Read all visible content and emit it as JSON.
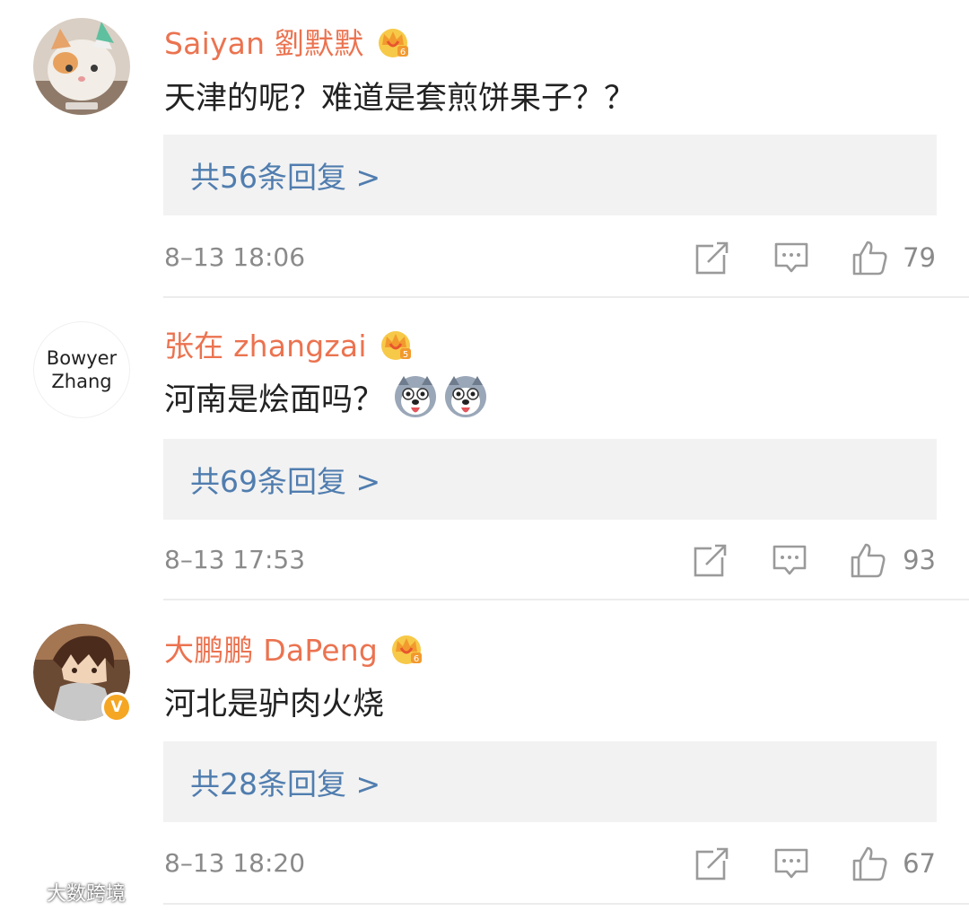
{
  "comments": [
    {
      "username": "Saiyan 劉默默",
      "level_badge": "6",
      "text": "天津的呢？难道是套煎饼果子？？",
      "replies": "共56条回复 >",
      "time": "8–13 18:06",
      "likes": "79",
      "avatar": "cat-photo"
    },
    {
      "username": "张在 zhangzai",
      "level_badge": "5",
      "text": "河南是烩面吗？",
      "replies": "共69条回复 >",
      "time": "8–13 17:53",
      "likes": "93",
      "avatar_text_line1": "Bowyer",
      "avatar_text_line2": "Zhang",
      "emojis": [
        "husky-emoji",
        "husky-emoji"
      ]
    },
    {
      "username": "大鹏鹏 DaPeng",
      "level_badge": "6",
      "text": "河北是驴肉火烧",
      "replies": "共28条回复 >",
      "time": "8–13 18:20",
      "likes": "67",
      "avatar": "anime-boy",
      "verified_badge": "V"
    }
  ],
  "watermark": "大数跨境",
  "colors": {
    "username": "#eb7350",
    "reply_link": "#507daf",
    "meta": "#8a8a8a",
    "reply_bg": "#f2f2f2"
  },
  "icons": [
    "repost-icon",
    "comment-icon",
    "like-icon",
    "crown-level-icon"
  ]
}
